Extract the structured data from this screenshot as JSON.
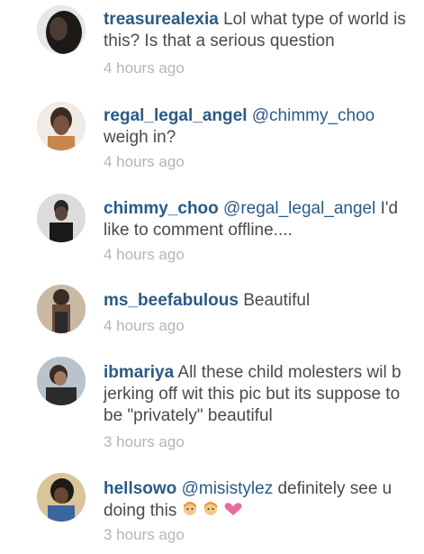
{
  "comments": [
    {
      "username": "treasurealexia",
      "mention": "",
      "text": "Lol what type of world is this? Is that a serious question",
      "time": "4 hours ago"
    },
    {
      "username": "regal_legal_angel",
      "mention": "@chimmy_choo",
      "text": "weigh in?",
      "time": "4 hours ago"
    },
    {
      "username": "chimmy_choo",
      "mention": "@regal_legal_angel",
      "text": "I'd like to comment offline....",
      "time": "4 hours ago"
    },
    {
      "username": "ms_beefabulous",
      "mention": "",
      "text": "Beautiful",
      "time": "4 hours ago"
    },
    {
      "username": "ibmariya",
      "mention": "",
      "text": "All these child molesters wil b jerking off wit this pic but its suppose to be \"privately\" beautiful",
      "time": "3 hours ago"
    },
    {
      "username": "hellsowo",
      "mention": "@misistylez",
      "text": "definitely see u doing this",
      "time": "3 hours ago",
      "emojis": [
        "girl-face-emoji",
        "girl-face-emoji",
        "heart-emoji"
      ]
    }
  ],
  "colors": {
    "username": "#2b5a86",
    "text": "#4a4a4a",
    "time": "#b5b5b5"
  }
}
